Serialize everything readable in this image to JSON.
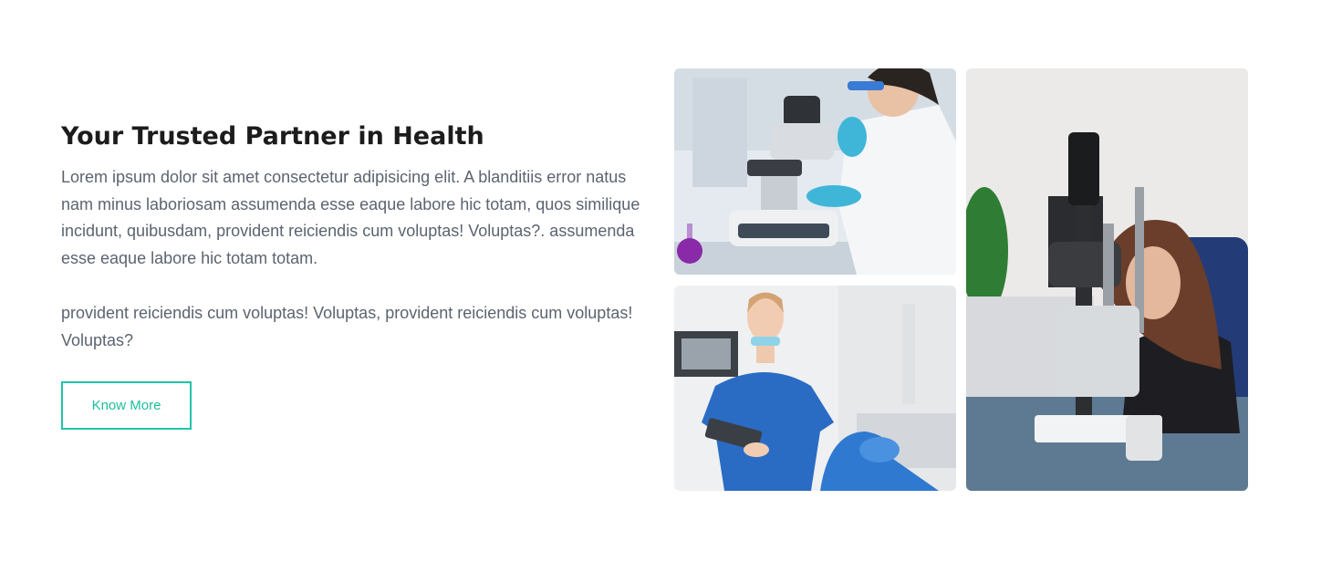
{
  "section": {
    "title": "Your Trusted Partner in Health",
    "paragraph_1": "Lorem ipsum dolor sit amet consectetur adipisicing elit. A blanditiis error natus nam minus laboriosam assumenda esse eaque labore hic totam, quos similique incidunt, quibusdam, provident reiciendis cum voluptas! Voluptas?. assumenda esse eaque labore hic totam totam.",
    "paragraph_2": "provident reiciendis cum voluptas! Voluptas, provident reiciendis cum voluptas! Voluptas?",
    "button_label": "Know More"
  },
  "colors": {
    "accent": "#1fc4a8",
    "heading": "#1c1c1c",
    "body_text": "#5b6470"
  }
}
